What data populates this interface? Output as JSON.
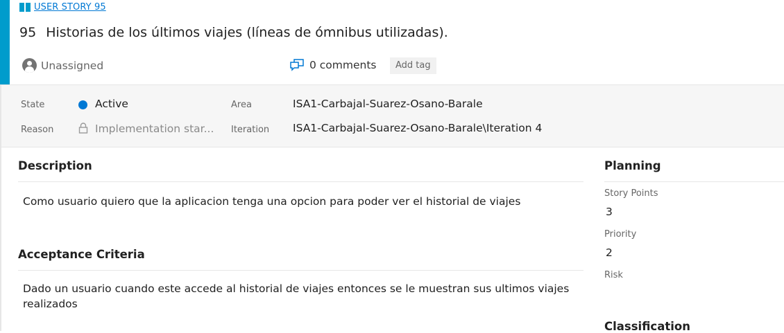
{
  "header": {
    "type_label": "USER STORY 95",
    "type_icon": "book-icon",
    "id": "95",
    "title": "Historias de los últimos viajes (líneas de ómnibus utilizadas).",
    "assignee": "Unassigned",
    "comments": "0 comments",
    "add_tag": "Add tag"
  },
  "fields": {
    "state_label": "State",
    "state_value": "Active",
    "reason_label": "Reason",
    "reason_value": "Implementation star...",
    "area_label": "Area",
    "area_value": "ISA1-Carbajal-Suarez-Osano-Barale",
    "iteration_label": "Iteration",
    "iteration_value": "ISA1-Carbajal-Suarez-Osano-Barale\\Iteration 4"
  },
  "description": {
    "title": "Description",
    "text": "Como usuario quiero que la aplicacion tenga una opcion para poder ver el historial de viajes"
  },
  "acceptance": {
    "title": "Acceptance Criteria",
    "text": "Dado un usuario cuando este accede al historial de viajes entonces se le muestran sus ultimos viajes realizados"
  },
  "planning": {
    "title": "Planning",
    "story_points_label": "Story Points",
    "story_points_value": "3",
    "priority_label": "Priority",
    "priority_value": "2",
    "risk_label": "Risk"
  },
  "classification": {
    "title": "Classification"
  },
  "colors": {
    "accent": "#009ccc",
    "link": "#0078d4",
    "state_active": "#0078d4"
  }
}
